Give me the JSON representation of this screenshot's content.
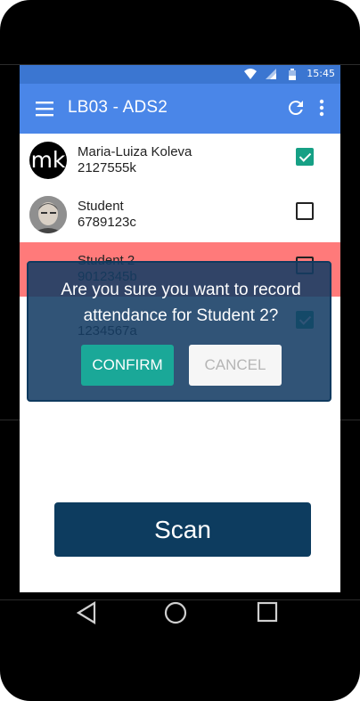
{
  "status_bar": {
    "time": "15:45"
  },
  "app_bar": {
    "title": "LB03 - ADS2"
  },
  "students": [
    {
      "initials": "mk",
      "name": "Maria-Luiza Koleva",
      "id": "2127555k",
      "checked": true
    },
    {
      "name": "Student",
      "id": "6789123c",
      "checked": false
    },
    {
      "name": "Student 2",
      "id": "9012345b",
      "checked": false,
      "highlighted": true
    },
    {
      "id": "1234567a",
      "checked": true
    }
  ],
  "dialog": {
    "message": "Are you sure you want to record attendance for Student 2?",
    "confirm_label": "CONFIRM",
    "cancel_label": "CANCEL"
  },
  "scan_label": "Scan",
  "colors": {
    "app_bar": "#4a86e8",
    "status_bar": "#3b76d1",
    "checkbox_checked": "#16a085",
    "highlight_row": "#ff7a7a",
    "dialog_bg": "#143c64",
    "confirm": "#1aa898",
    "scan_button": "#0d3c5f"
  }
}
